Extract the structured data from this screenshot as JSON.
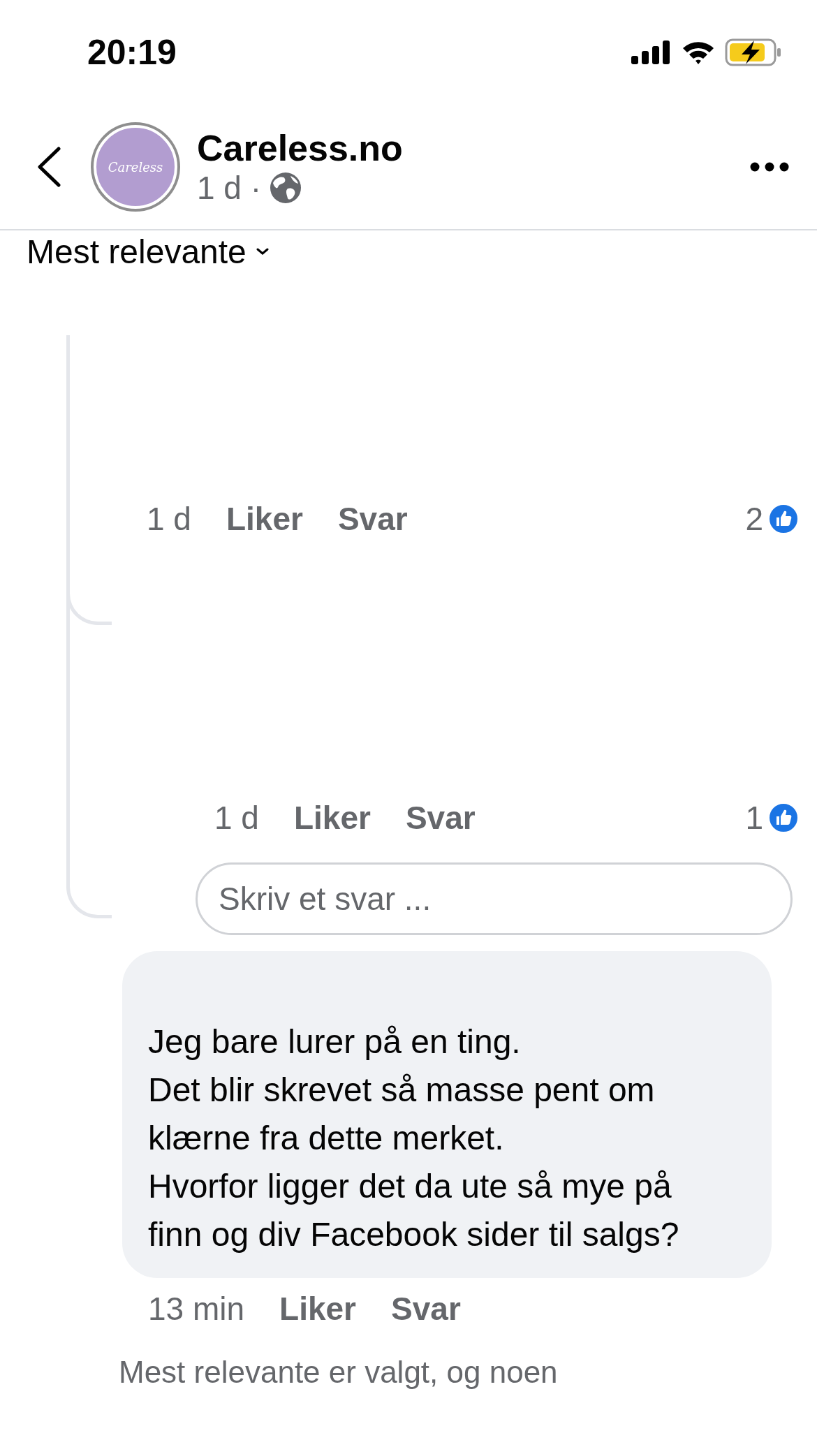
{
  "status_bar": {
    "time": "20:19"
  },
  "header": {
    "avatar_text": "Careless",
    "title": "Careless.no",
    "meta": "1 d ·"
  },
  "sort": {
    "label": "Mest relevante"
  },
  "replies": [
    {
      "time": "1 d",
      "like": "Liker",
      "reply": "Svar",
      "reaction_count": "2"
    },
    {
      "time": "1 d",
      "like": "Liker",
      "reply": "Svar",
      "reaction_count": "1"
    }
  ],
  "reply_field": {
    "placeholder": "Skriv et svar ..."
  },
  "comment": {
    "text": "Jeg bare lurer på en ting.\nDet blir skrevet så masse pent om klærne fra dette merket.\nHvorfor ligger det da ute så mye på finn og div Facebook sider til salgs?",
    "time": "13 min",
    "like": "Liker",
    "reply": "Svar"
  },
  "footer_note": "Mest relevante er valgt, og noen"
}
